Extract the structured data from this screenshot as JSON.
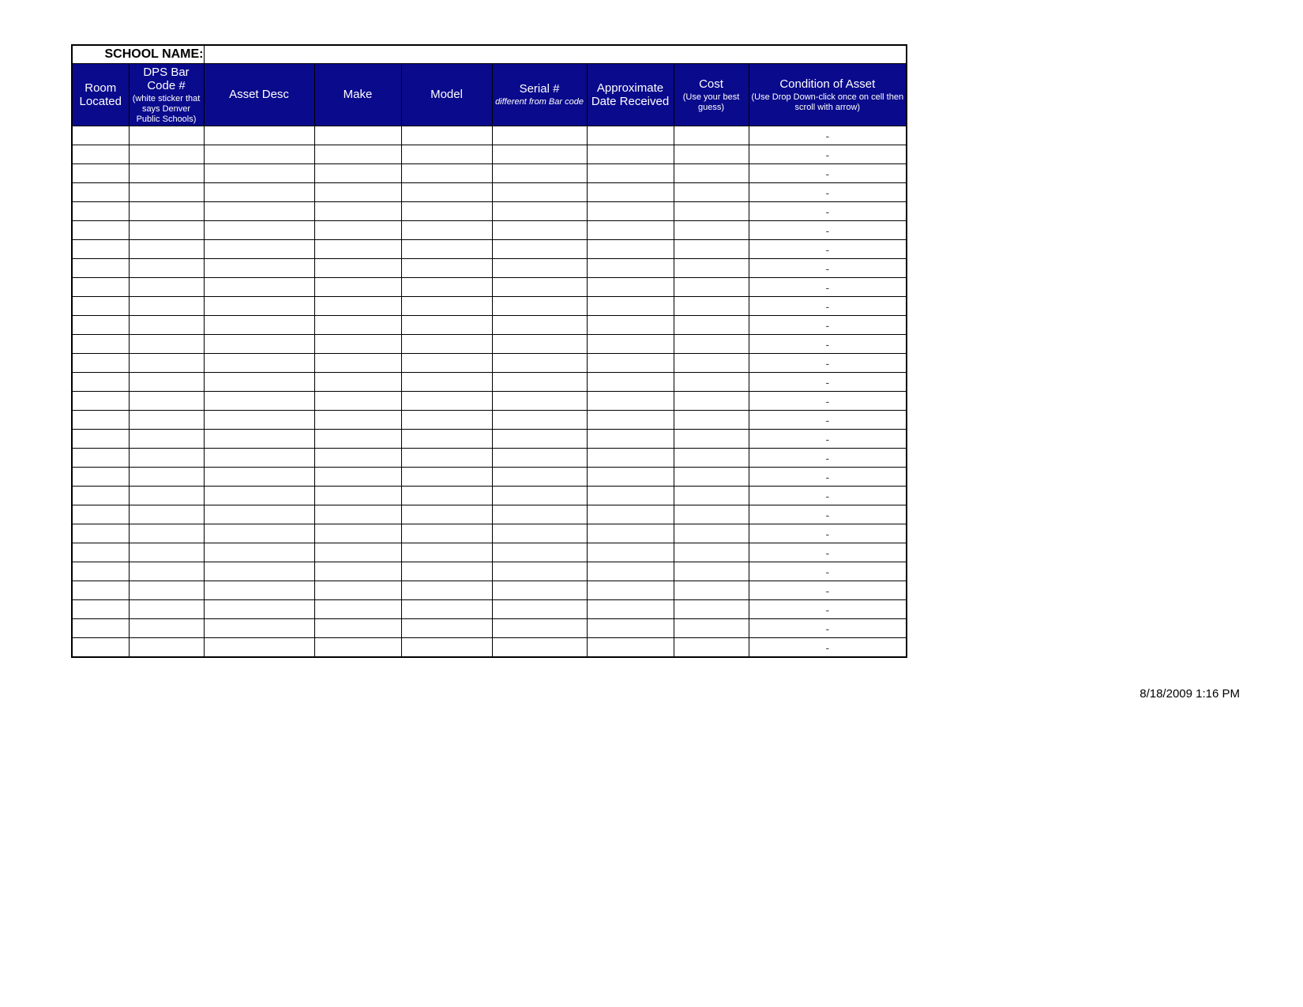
{
  "school_name_label": "SCHOOL NAME:",
  "school_name_value": "",
  "headers": {
    "room": {
      "main": "Room Located"
    },
    "barcode": {
      "main": "DPS Bar Code #",
      "sub": "(white sticker that says Denver Public Schools)"
    },
    "desc": {
      "main": "Asset Desc"
    },
    "make": {
      "main": "Make"
    },
    "model": {
      "main": "Model"
    },
    "serial": {
      "main": "Serial #",
      "subi": "different from Bar code"
    },
    "date": {
      "main": "Approximate Date Received"
    },
    "cost": {
      "main": "Cost",
      "sub": "(Use your best guess)"
    },
    "condition": {
      "main": "Condition of Asset",
      "sub": "(Use Drop Down-click once on cell then scroll with arrow)"
    }
  },
  "rows": [
    {
      "room": "",
      "barcode": "",
      "desc": "",
      "make": "",
      "model": "",
      "serial": "",
      "date": "",
      "cost": "",
      "condition": "-"
    },
    {
      "room": "",
      "barcode": "",
      "desc": "",
      "make": "",
      "model": "",
      "serial": "",
      "date": "",
      "cost": "",
      "condition": "-"
    },
    {
      "room": "",
      "barcode": "",
      "desc": "",
      "make": "",
      "model": "",
      "serial": "",
      "date": "",
      "cost": "",
      "condition": "-"
    },
    {
      "room": "",
      "barcode": "",
      "desc": "",
      "make": "",
      "model": "",
      "serial": "",
      "date": "",
      "cost": "",
      "condition": "-"
    },
    {
      "room": "",
      "barcode": "",
      "desc": "",
      "make": "",
      "model": "",
      "serial": "",
      "date": "",
      "cost": "",
      "condition": "-"
    },
    {
      "room": "",
      "barcode": "",
      "desc": "",
      "make": "",
      "model": "",
      "serial": "",
      "date": "",
      "cost": "",
      "condition": "-"
    },
    {
      "room": "",
      "barcode": "",
      "desc": "",
      "make": "",
      "model": "",
      "serial": "",
      "date": "",
      "cost": "",
      "condition": "-"
    },
    {
      "room": "",
      "barcode": "",
      "desc": "",
      "make": "",
      "model": "",
      "serial": "",
      "date": "",
      "cost": "",
      "condition": "-"
    },
    {
      "room": "",
      "barcode": "",
      "desc": "",
      "make": "",
      "model": "",
      "serial": "",
      "date": "",
      "cost": "",
      "condition": "-"
    },
    {
      "room": "",
      "barcode": "",
      "desc": "",
      "make": "",
      "model": "",
      "serial": "",
      "date": "",
      "cost": "",
      "condition": "-"
    },
    {
      "room": "",
      "barcode": "",
      "desc": "",
      "make": "",
      "model": "",
      "serial": "",
      "date": "",
      "cost": "",
      "condition": "-"
    },
    {
      "room": "",
      "barcode": "",
      "desc": "",
      "make": "",
      "model": "",
      "serial": "",
      "date": "",
      "cost": "",
      "condition": "-"
    },
    {
      "room": "",
      "barcode": "",
      "desc": "",
      "make": "",
      "model": "",
      "serial": "",
      "date": "",
      "cost": "",
      "condition": "-"
    },
    {
      "room": "",
      "barcode": "",
      "desc": "",
      "make": "",
      "model": "",
      "serial": "",
      "date": "",
      "cost": "",
      "condition": "-"
    },
    {
      "room": "",
      "barcode": "",
      "desc": "",
      "make": "",
      "model": "",
      "serial": "",
      "date": "",
      "cost": "",
      "condition": "-"
    },
    {
      "room": "",
      "barcode": "",
      "desc": "",
      "make": "",
      "model": "",
      "serial": "",
      "date": "",
      "cost": "",
      "condition": "-"
    },
    {
      "room": "",
      "barcode": "",
      "desc": "",
      "make": "",
      "model": "",
      "serial": "",
      "date": "",
      "cost": "",
      "condition": "-"
    },
    {
      "room": "",
      "barcode": "",
      "desc": "",
      "make": "",
      "model": "",
      "serial": "",
      "date": "",
      "cost": "",
      "condition": "-"
    },
    {
      "room": "",
      "barcode": "",
      "desc": "",
      "make": "",
      "model": "",
      "serial": "",
      "date": "",
      "cost": "",
      "condition": "-"
    },
    {
      "room": "",
      "barcode": "",
      "desc": "",
      "make": "",
      "model": "",
      "serial": "",
      "date": "",
      "cost": "",
      "condition": "-"
    },
    {
      "room": "",
      "barcode": "",
      "desc": "",
      "make": "",
      "model": "",
      "serial": "",
      "date": "",
      "cost": "",
      "condition": "-"
    },
    {
      "room": "",
      "barcode": "",
      "desc": "",
      "make": "",
      "model": "",
      "serial": "",
      "date": "",
      "cost": "",
      "condition": "-"
    },
    {
      "room": "",
      "barcode": "",
      "desc": "",
      "make": "",
      "model": "",
      "serial": "",
      "date": "",
      "cost": "",
      "condition": "-"
    },
    {
      "room": "",
      "barcode": "",
      "desc": "",
      "make": "",
      "model": "",
      "serial": "",
      "date": "",
      "cost": "",
      "condition": "-"
    },
    {
      "room": "",
      "barcode": "",
      "desc": "",
      "make": "",
      "model": "",
      "serial": "",
      "date": "",
      "cost": "",
      "condition": "-"
    },
    {
      "room": "",
      "barcode": "",
      "desc": "",
      "make": "",
      "model": "",
      "serial": "",
      "date": "",
      "cost": "",
      "condition": "-"
    },
    {
      "room": "",
      "barcode": "",
      "desc": "",
      "make": "",
      "model": "",
      "serial": "",
      "date": "",
      "cost": "",
      "condition": "-"
    },
    {
      "room": "",
      "barcode": "",
      "desc": "",
      "make": "",
      "model": "",
      "serial": "",
      "date": "",
      "cost": "",
      "condition": "-"
    }
  ],
  "footer_timestamp": "8/18/2009 1:16 PM"
}
